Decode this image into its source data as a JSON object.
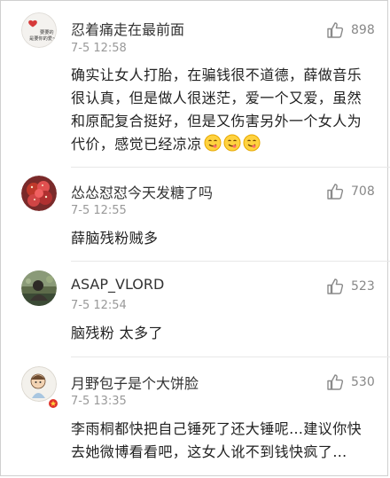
{
  "comments": [
    {
      "username": "忍着痛走在最前面",
      "time": "7-5 12:58",
      "likes": "898",
      "avatar_text_line1": "要要的",
      "avatar_text_line2": "是要你的爱~",
      "lines": [
        "确实让女人打胎，在骗钱很不道德，薛做音乐",
        "很认真，但是做人很迷茫，爱一个又爱，虽然",
        "和原配复合挺好，但是又伤害另外一个女人为",
        "代价，感觉已经凉凉"
      ],
      "emoji_name": "yummy-face-emoji"
    },
    {
      "username": "怂怂怼怼今天发糖了吗",
      "time": "7-5 12:55",
      "likes": "708",
      "lines": [
        "薛脑残粉贼多"
      ]
    },
    {
      "username": "ASAP_VLORD",
      "time": "7-5 12:54",
      "likes": "523",
      "lines": [
        "脑残粉 太多了"
      ]
    },
    {
      "username": "月野包子是个大饼脸",
      "time": "7-5 13:35",
      "likes": "530",
      "lines": [
        "李雨桐都快把自己锤死了还大锤呢…建议你快",
        "去她微博看看吧，这女人讹不到钱快疯了…"
      ]
    }
  ],
  "icons": {
    "like": "thumbs-up-icon"
  },
  "colors": {
    "username": "#333333",
    "time": "#999999",
    "text": "#222222",
    "like": "#888888"
  }
}
